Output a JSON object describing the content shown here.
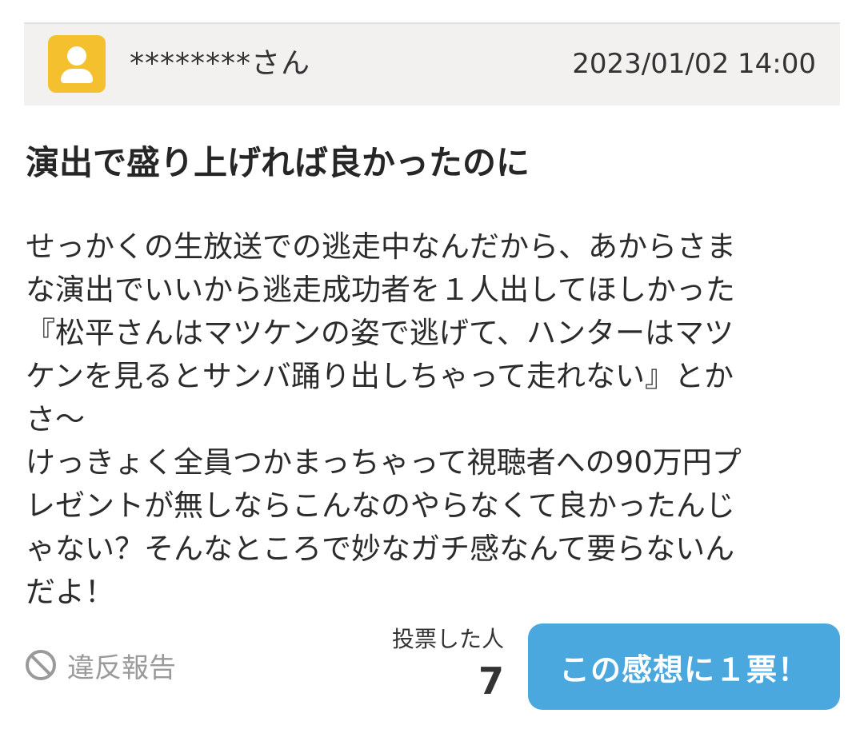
{
  "header": {
    "avatar_icon": "user-icon",
    "username": "********さん",
    "datetime": "2023/01/02 14:00"
  },
  "review": {
    "title": "演出で盛り上げれば良かったのに",
    "body_lines": [
      "せっかくの生放送での逃走中なんだから、あからさま",
      "な演出でいいから逃走成功者を１人出してほしかった",
      "『松平さんはマツケンの姿で逃げて、ハンターはマツ",
      "ケンを見るとサンバ踊り出しちゃって走れない』とか",
      "さ～",
      "けっきょく全員つかまっちゃって視聴者への90万円プ",
      "レゼントが無しならこんなのやらなくて良かったんじ",
      "ゃない？そんなところで妙なガチ感なんて要らないん",
      "だよ！"
    ]
  },
  "footer": {
    "report_icon": "prohibited-icon",
    "report_label": "違反報告",
    "vote_label": "投票した人",
    "vote_count": "7",
    "vote_button_label": "この感想に１票！"
  },
  "colors": {
    "accent": "#4aa8df",
    "avatar": "#f5c02e",
    "header_bg": "#f2f1f0",
    "muted": "#9a9a9a"
  }
}
